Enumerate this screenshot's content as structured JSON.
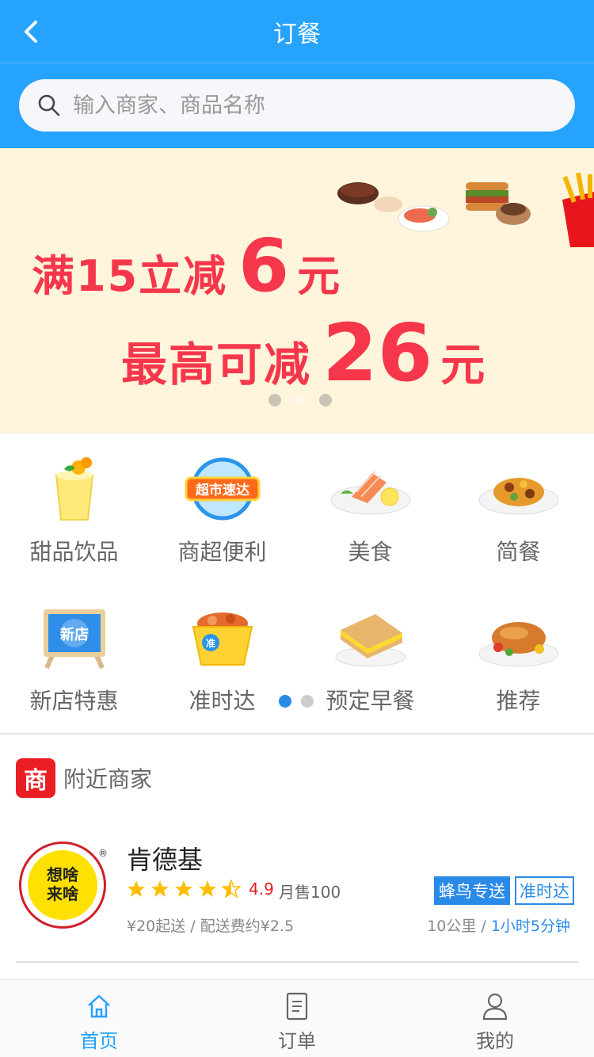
{
  "header": {
    "title": "订餐"
  },
  "search": {
    "placeholder": "输入商家、商品名称"
  },
  "banner": {
    "line1_text": "满15立减",
    "line1_amount": "6",
    "line1_unit": "元",
    "line2_text": "最高可减",
    "line2_amount": "26",
    "line2_unit": "元",
    "pages": 3,
    "active_page": 1,
    "text_color": "#f6374b",
    "bg_color": "#fff5dc"
  },
  "categories": {
    "items": [
      {
        "label": "甜品饮品",
        "icon": "dessert-drink-icon"
      },
      {
        "label": "商超便利",
        "icon": "supermarket-icon",
        "icon_text": "超市速达"
      },
      {
        "label": "美食",
        "icon": "salmon-dish-icon"
      },
      {
        "label": "简餐",
        "icon": "simple-meal-icon"
      },
      {
        "label": "新店特惠",
        "icon": "new-store-icon",
        "icon_text": "新店"
      },
      {
        "label": "准时达",
        "icon": "on-time-box-icon",
        "icon_text": "准"
      },
      {
        "label": "预定早餐",
        "icon": "sandwich-icon"
      },
      {
        "label": "推荐",
        "icon": "roast-chicken-icon"
      }
    ],
    "pages": 2,
    "active_page": 0
  },
  "nearby": {
    "badge": "商",
    "title": "附近商家"
  },
  "shops": [
    {
      "name": "肯德基",
      "logo_text_1": "想啥",
      "logo_text_2": "来啥",
      "rating": 4.5,
      "score": "4.9",
      "monthly_sales": "月售100",
      "min_fee": "¥20起送 / 配送费约¥2.5",
      "tag_delivery": "蜂鸟专送",
      "tag_ontime": "准时达",
      "distance": "10公里 /",
      "time": "1小时5分钟"
    }
  ],
  "tabbar": {
    "items": [
      {
        "label": "首页",
        "icon": "home-icon",
        "active": true
      },
      {
        "label": "订单",
        "icon": "order-icon",
        "active": false
      },
      {
        "label": "我的",
        "icon": "profile-icon",
        "active": false
      }
    ]
  },
  "colors": {
    "primary": "#26a2ff",
    "accent": "#2a8ae8",
    "star": "#ffbe00",
    "brand_red": "#ea1f25"
  }
}
